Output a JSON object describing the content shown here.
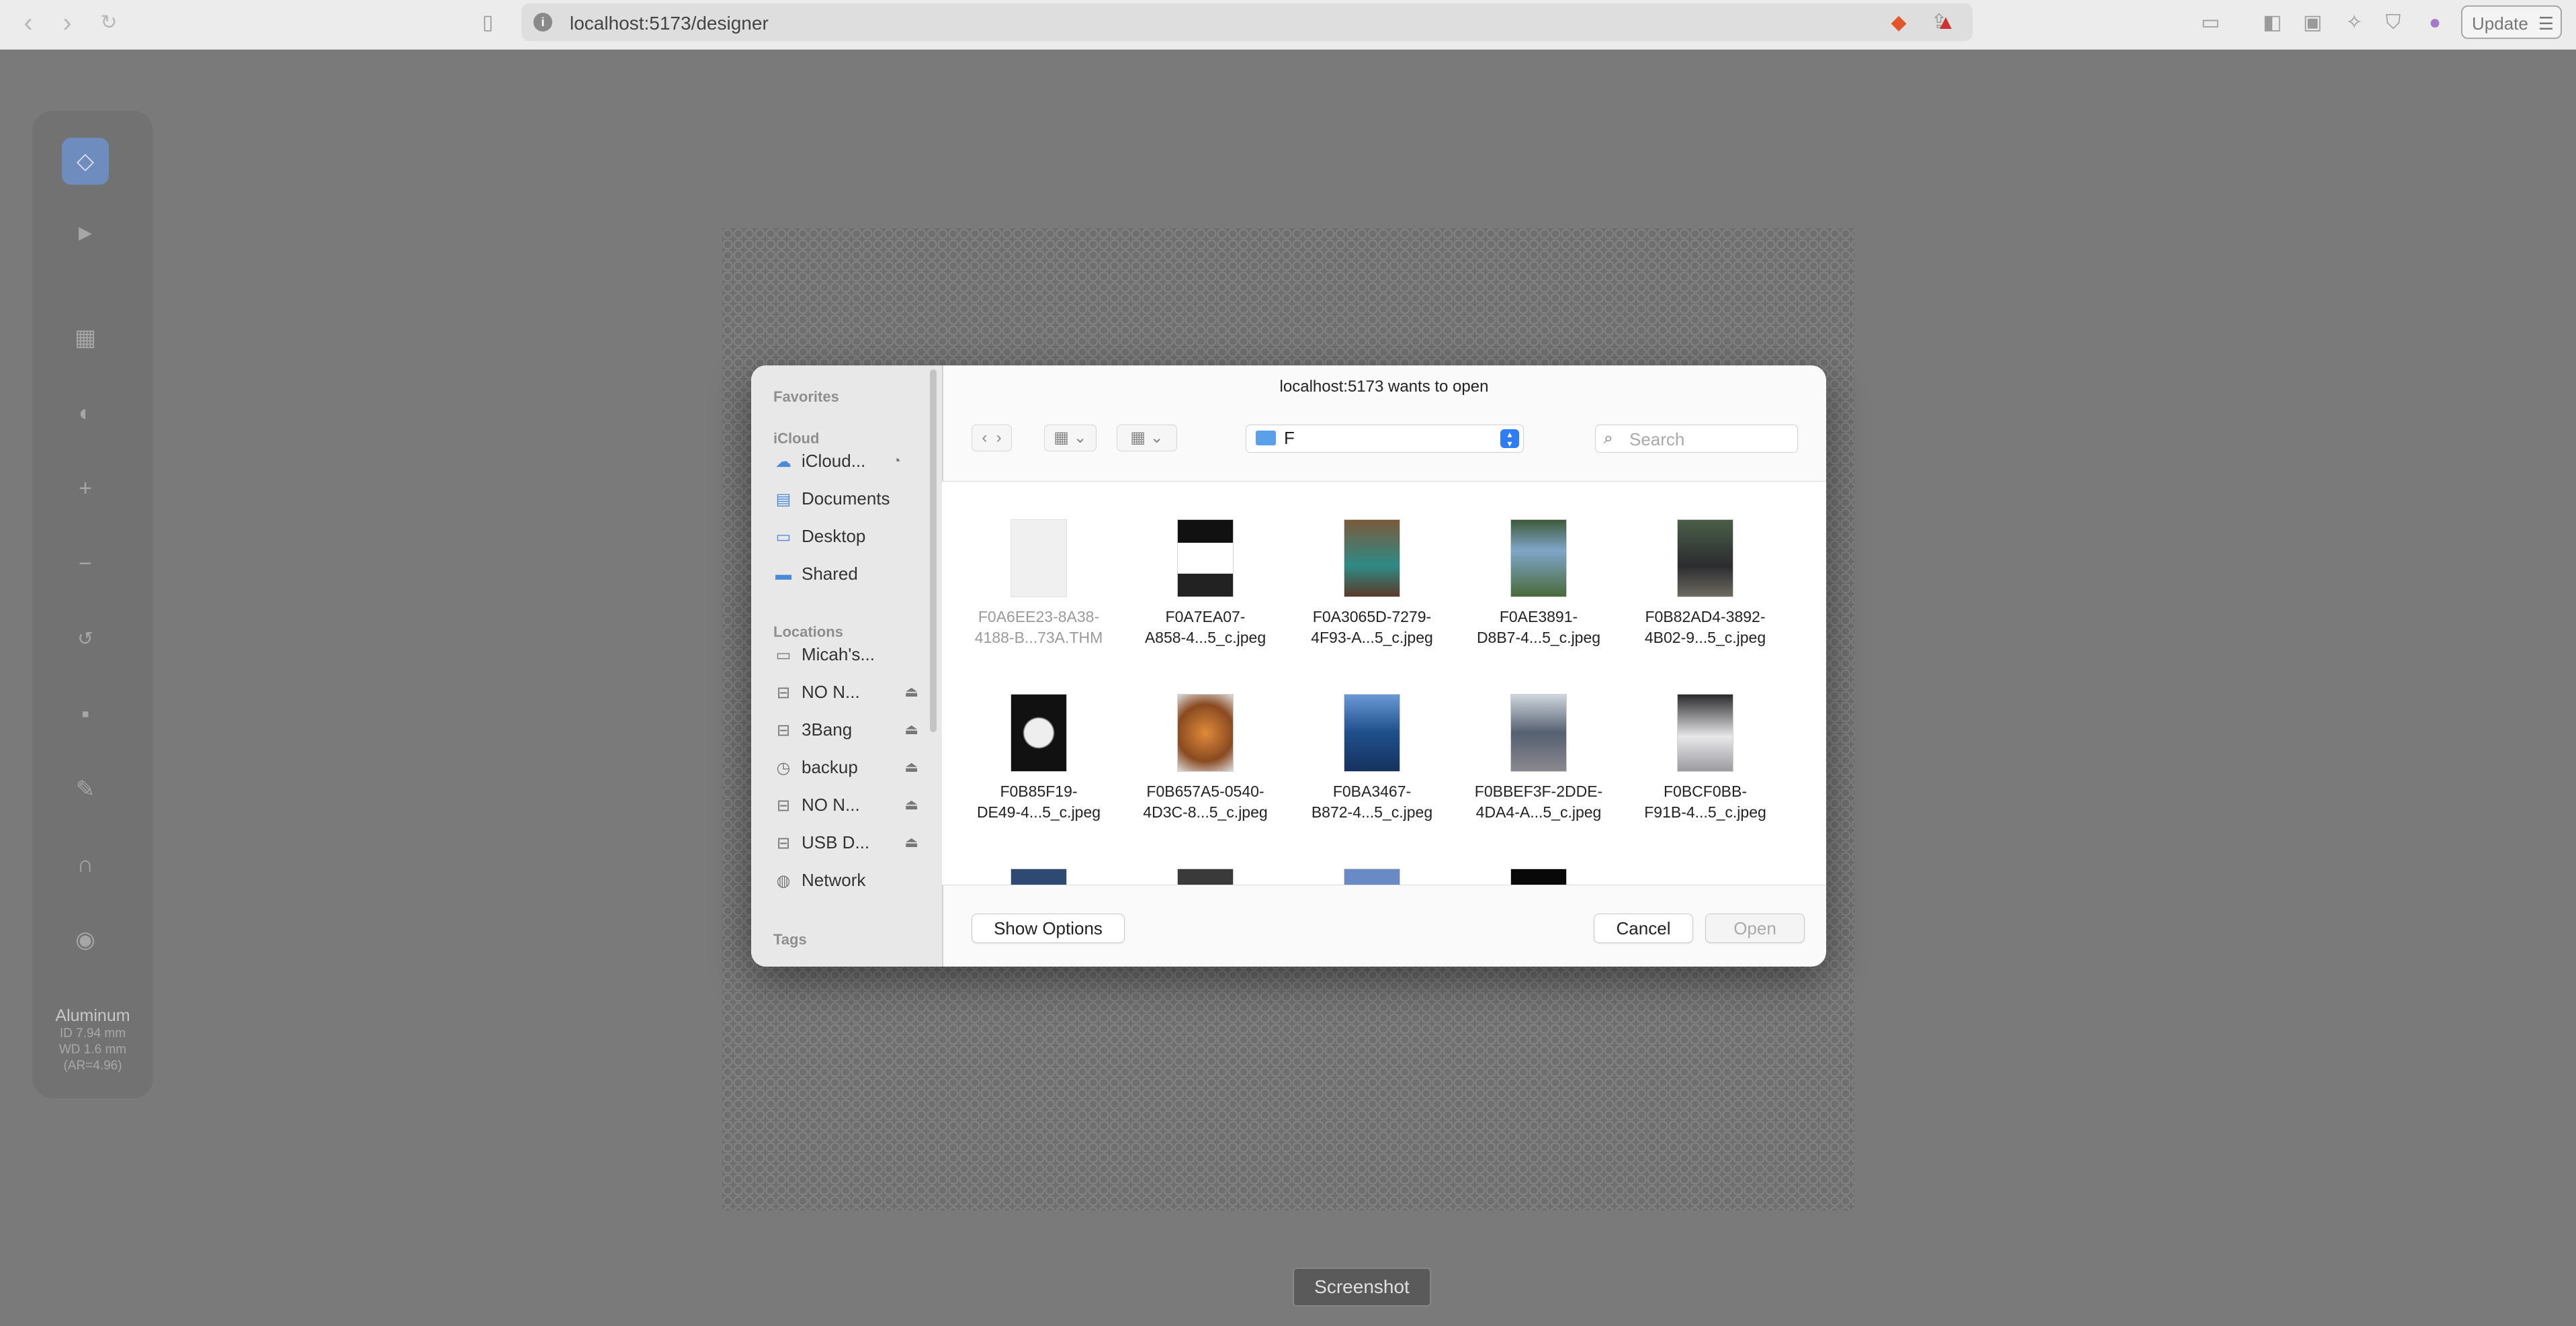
{
  "browser": {
    "url": "localhost:5173/designer",
    "update_label": "Update"
  },
  "toolbar": {
    "material_name": "Aluminum",
    "material_id": "ID 7.94 mm",
    "material_wd": "WD 1.6 mm",
    "material_ar": "(AR=4.96)"
  },
  "tooltip": "Screenshot",
  "dialog": {
    "title": "localhost:5173 wants to open",
    "location": "F",
    "search_placeholder": "Search",
    "show_options_label": "Show Options",
    "cancel_label": "Cancel",
    "open_label": "Open"
  },
  "sidebar": {
    "favorites_heading": "Favorites",
    "icloud_heading": "iCloud",
    "locations_heading": "Locations",
    "tags_heading": "Tags",
    "icloud_items": [
      "iCloud...",
      "Documents",
      "Desktop",
      "Shared"
    ],
    "location_items": [
      "Micah's...",
      "NO N...",
      "3Bang",
      "backup",
      "NO N...",
      "USB D...",
      "Network"
    ]
  },
  "files": [
    {
      "line1": "F0A6EE23-8A38-",
      "line2": "4188-B...73A.THM"
    },
    {
      "line1": "F0A7EA07-",
      "line2": "A858-4...5_c.jpeg"
    },
    {
      "line1": "F0A3065D-7279-",
      "line2": "4F93-A...5_c.jpeg"
    },
    {
      "line1": "F0AE3891-",
      "line2": "D8B7-4...5_c.jpeg"
    },
    {
      "line1": "F0B82AD4-3892-",
      "line2": "4B02-9...5_c.jpeg"
    },
    {
      "line1": "F0B85F19-",
      "line2": "DE49-4...5_c.jpeg"
    },
    {
      "line1": "F0B657A5-0540-",
      "line2": "4D3C-8...5_c.jpeg"
    },
    {
      "line1": "F0BA3467-",
      "line2": "B872-4...5_c.jpeg"
    },
    {
      "line1": "F0BBEF3F-2DDE-",
      "line2": "4DA4-A...5_c.jpeg"
    },
    {
      "line1": "F0BCF0BB-",
      "line2": "F91B-4...5_c.jpeg"
    }
  ],
  "colors": {
    "accent": "#2f7cf6",
    "folder": "#5aa0e8",
    "active_tool": "#6f8cbf"
  }
}
